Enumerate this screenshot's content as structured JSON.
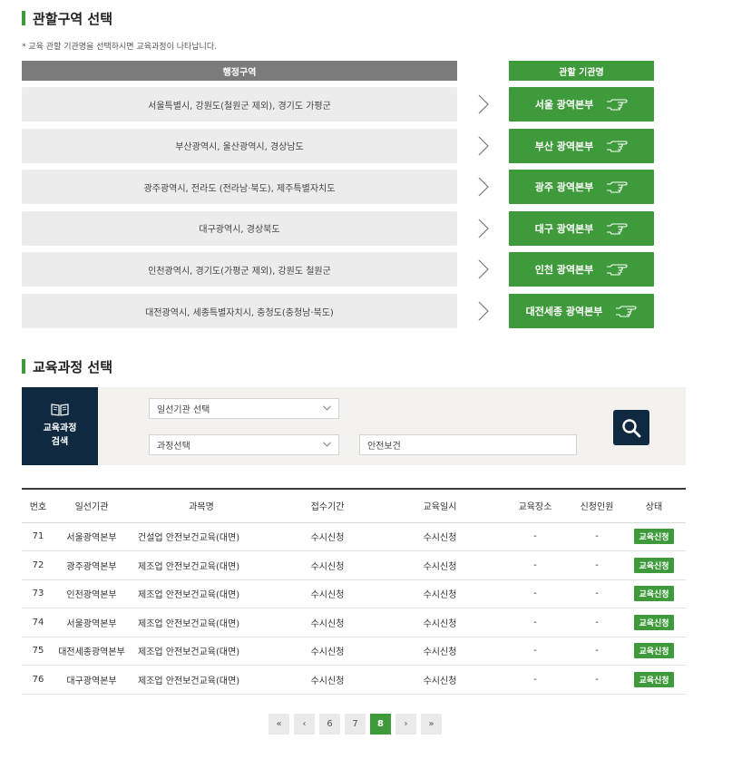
{
  "region_section": {
    "title": "관할구역 선택",
    "note": "* 교육 관할 기관명을 선택하시면 교육과정이 나타납니다.",
    "header_admin": "행정구역",
    "header_agency": "관할 기관명",
    "rows": [
      {
        "region": "서울특별시, 강원도(철원군 제외), 경기도 가평군",
        "agency": "서울 광역본부"
      },
      {
        "region": "부산광역시, 울산광역시, 경상남도",
        "agency": "부산 광역본부"
      },
      {
        "region": "광주광역시, 전라도 (전라남·북도), 제주특별자치도",
        "agency": "광주 광역본부"
      },
      {
        "region": "대구광역시, 경상북도",
        "agency": "대구 광역본부"
      },
      {
        "region": "인천광역시, 경기도(가평군 제외), 강원도 철원군",
        "agency": "인천 광역본부"
      },
      {
        "region": "대전광역시, 세종특별자치시, 충청도(충청남·북도)",
        "agency": "대전세종 광역본부"
      }
    ]
  },
  "course_section": {
    "title": "교육과정 선택",
    "search_label_line1": "교육과정",
    "search_label_line2": "검색",
    "institution_select": "일선기관 선택",
    "course_select": "과정선택",
    "keyword_value": "안전보건"
  },
  "table": {
    "headers": [
      "번호",
      "일선기관",
      "과목명",
      "접수기간",
      "교육일시",
      "교육장소",
      "신청인원",
      "상태"
    ],
    "rows": [
      [
        "71",
        "서울광역본부",
        "건설업 안전보건교육(대면)",
        "수시신청",
        "수시신청",
        "-",
        "-",
        "교육신청"
      ],
      [
        "72",
        "광주광역본부",
        "제조업 안전보건교육(대면)",
        "수시신청",
        "수시신청",
        "-",
        "-",
        "교육신청"
      ],
      [
        "73",
        "인천광역본부",
        "제조업 안전보건교육(대면)",
        "수시신청",
        "수시신청",
        "-",
        "-",
        "교육신청"
      ],
      [
        "74",
        "서울광역본부",
        "제조업 안전보건교육(대면)",
        "수시신청",
        "수시신청",
        "-",
        "-",
        "교육신청"
      ],
      [
        "75",
        "대전세종광역본부",
        "제조업 안전보건교육(대면)",
        "수시신청",
        "수시신청",
        "-",
        "-",
        "교육신청"
      ],
      [
        "76",
        "대구광역본부",
        "제조업 안전보건교육(대면)",
        "수시신청",
        "수시신청",
        "-",
        "-",
        "교육신청"
      ]
    ]
  },
  "pagination": {
    "first": "«",
    "prev": "‹",
    "pages": [
      "6",
      "7",
      "8"
    ],
    "current": "8",
    "next": "›",
    "last": "»"
  },
  "colors": {
    "accent_green": "#3e9a3a",
    "navy": "#0f2a40",
    "header_gray": "#7b7b7b"
  },
  "icons": {
    "agency_button": "pointing-hand-icon",
    "region_separator": "chevron-right-icon",
    "search_label": "open-book-icon",
    "search_button": "search-icon",
    "select_toggle": "chevron-down-icon"
  }
}
